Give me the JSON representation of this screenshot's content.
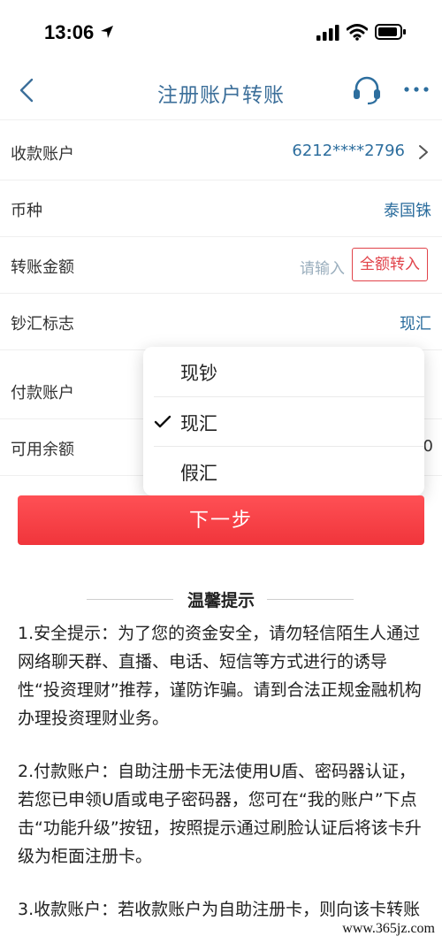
{
  "status_bar": {
    "time": "13:06"
  },
  "nav": {
    "title": "注册账户转账",
    "icons": [
      "back-icon",
      "customer-service-icon",
      "more-icon"
    ]
  },
  "form": {
    "payee_account": {
      "label": "收款账户",
      "value": "6212****2796"
    },
    "currency": {
      "label": "币种",
      "value": "泰国铢"
    },
    "amount": {
      "label": "转账金额",
      "placeholder": "请输入",
      "full_button": "全额转入"
    },
    "cash_remit": {
      "label": "钞汇标志",
      "value": "现汇"
    },
    "payer_account": {
      "label": "付款账户"
    },
    "balance": {
      "label": "可用余额",
      "value_partial": "0"
    }
  },
  "dropdown": {
    "options": [
      {
        "label": "现钞",
        "selected": false
      },
      {
        "label": "现汇",
        "selected": true
      },
      {
        "label": "假汇",
        "selected": false
      }
    ]
  },
  "next_button": "下一步",
  "tips": {
    "title": "温馨提示",
    "items": [
      "1.安全提示：为了您的资金安全，请勿轻信陌生人通过网络聊天群、直播、电话、短信等方式进行的诱导性“投资理财”推荐，谨防诈骗。请到合法正规金融机构办理投资理财业务。",
      "2.付款账户：自助注册卡无法使用U盾、密码器认证，若您已申领U盾或电子密码器，您可在“我的账户”下点击“功能升级”按钮，按照提示通过刷脸认证后将该卡升级为柜面注册卡。",
      "3.收款账户：若收款账户为自助注册卡，则向该卡转账"
    ]
  },
  "watermark": "www.365jz.com",
  "colors": {
    "accent_blue": "#2d6e9e",
    "title_blue": "#3c6f9a",
    "primary_red": "#f0353b"
  }
}
